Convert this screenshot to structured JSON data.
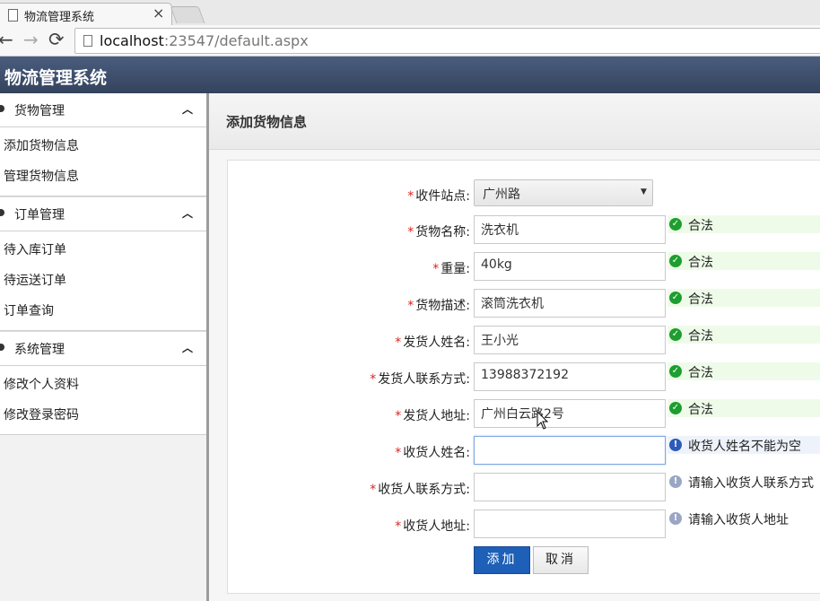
{
  "browser": {
    "tab_title": "物流管理系统",
    "tab_close": "×",
    "url_host": "localhost",
    "url_rest": ":23547/default.aspx",
    "nav_back": "←",
    "nav_forward": "→",
    "nav_reload": "⟳"
  },
  "app": {
    "title": "物流管理系统"
  },
  "sidebar": {
    "groups": [
      {
        "label": "货物管理",
        "chevron": "︿",
        "items": [
          "添加货物信息",
          "管理货物信息"
        ]
      },
      {
        "label": "订单管理",
        "chevron": "︿",
        "items": [
          "待入库订单",
          "待运送订单",
          "订单查询"
        ]
      },
      {
        "label": "系统管理",
        "chevron": "︿",
        "items": [
          "修改个人资料",
          "修改登录密码"
        ]
      }
    ]
  },
  "panel": {
    "title": "添加货物信息"
  },
  "form": {
    "required_mark": "*",
    "station": {
      "label": "收件站点:",
      "value": "广州路",
      "arrow": "▼"
    },
    "fields": [
      {
        "label": "货物名称:",
        "value": "洗衣机",
        "msg": "合法",
        "state": "ok"
      },
      {
        "label": "重量:",
        "value": "40kg",
        "msg": "合法",
        "state": "ok"
      },
      {
        "label": "货物描述:",
        "value": "滚筒洗衣机",
        "msg": "合法",
        "state": "ok"
      },
      {
        "label": "发货人姓名:",
        "value": "王小光",
        "msg": "合法",
        "state": "ok"
      },
      {
        "label": "发货人联系方式:",
        "value": "13988372192",
        "msg": "合法",
        "state": "ok"
      },
      {
        "label": "发货人地址:",
        "value": "广州白云路2号",
        "msg": "合法",
        "state": "ok"
      },
      {
        "label": "收货人姓名:",
        "value": "",
        "msg": "收货人姓名不能为空",
        "state": "err"
      },
      {
        "label": "收货人联系方式:",
        "value": "",
        "msg": "请输入收货人联系方式",
        "state": "info"
      },
      {
        "label": "收货人地址:",
        "value": "",
        "msg": "请输入收货人地址",
        "state": "info"
      }
    ],
    "add_button": "添加",
    "cancel_button": "取消"
  },
  "colors": {
    "header": "#3d4d6a",
    "ok": "#1d9e2f",
    "error": "#2c5bb8",
    "required": "#d9261c",
    "primary_button": "#1e5fb7"
  }
}
